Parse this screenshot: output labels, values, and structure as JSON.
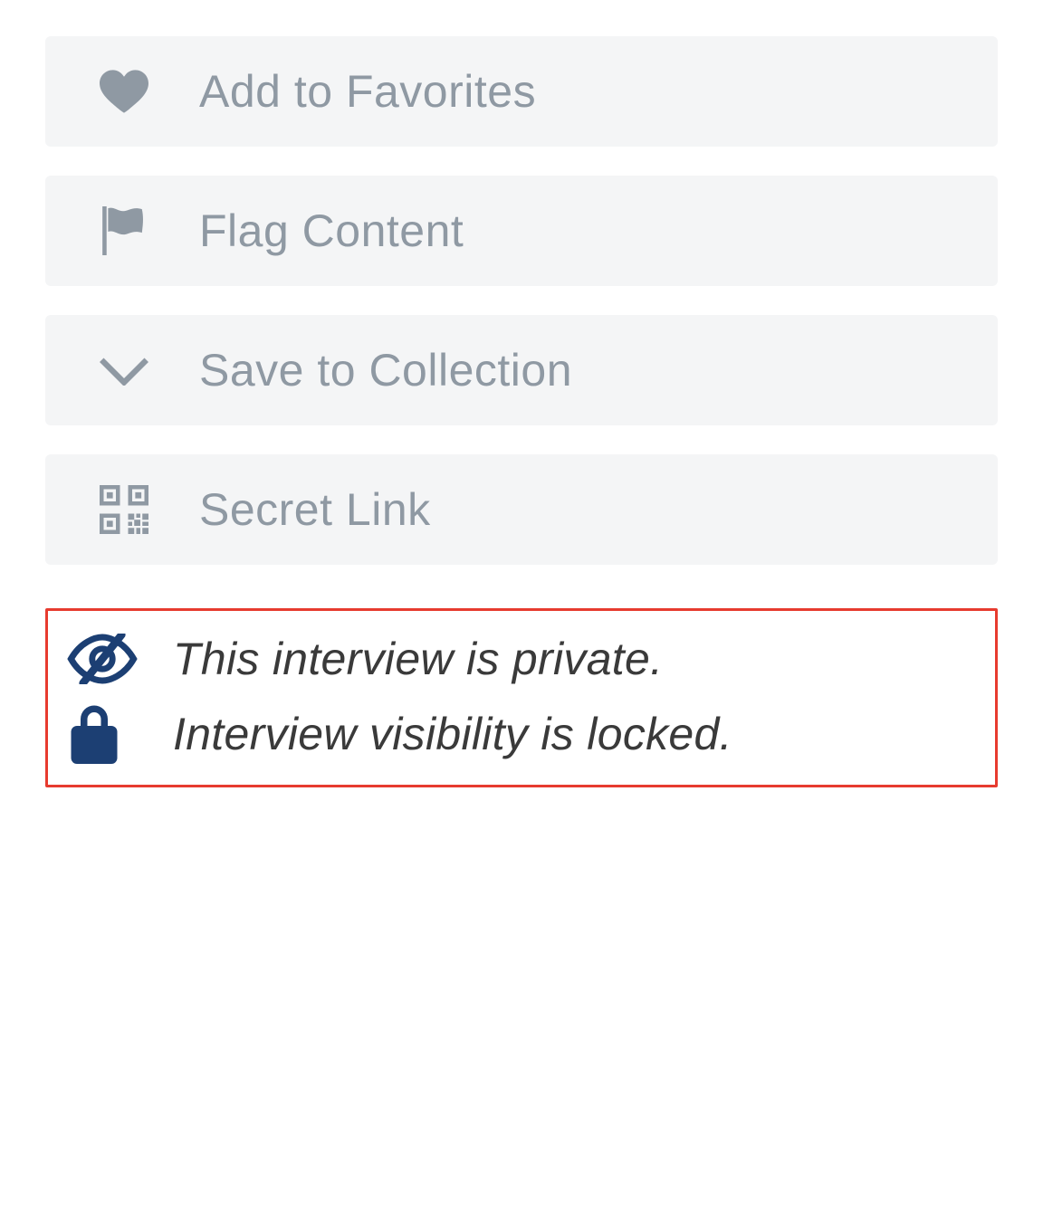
{
  "actions": {
    "favorites": {
      "label": "Add to Favorites",
      "icon": "heart-icon"
    },
    "flag": {
      "label": "Flag Content",
      "icon": "flag-icon"
    },
    "collection": {
      "label": "Save to Collection",
      "icon": "chevron-down-icon"
    },
    "secret_link": {
      "label": "Secret Link",
      "icon": "qrcode-icon"
    }
  },
  "status": {
    "private": {
      "text": "This interview is private.",
      "icon": "eye-slash-icon"
    },
    "locked": {
      "text": "Interview visibility is locked.",
      "icon": "lock-icon"
    }
  },
  "colors": {
    "button_bg": "#f4f5f6",
    "button_text": "#8f99a3",
    "status_border": "#e73b2f",
    "status_icon": "#1c3f73",
    "status_text": "#3a3a3a"
  }
}
